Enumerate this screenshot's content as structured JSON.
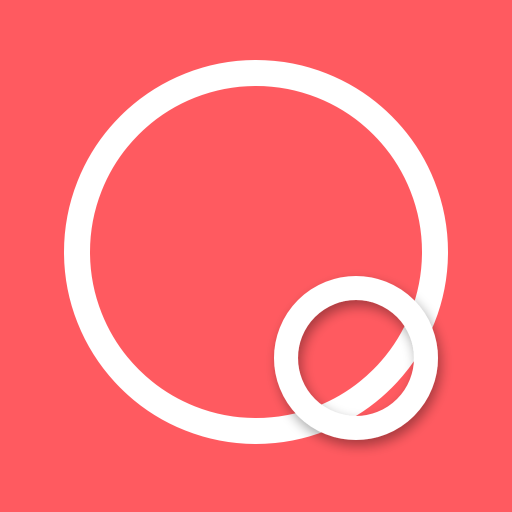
{
  "icon": {
    "name": "circle-rings-logo",
    "background_color": "#FF5A60",
    "ring_color": "#FFFFFF",
    "shadow_color": "#000000"
  }
}
